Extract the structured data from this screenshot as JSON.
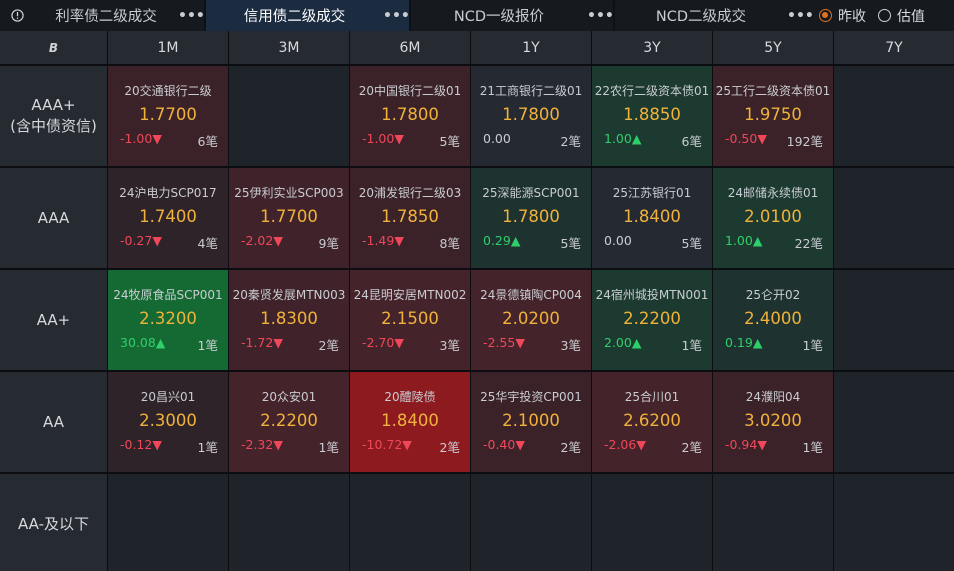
{
  "tabs": [
    {
      "label": "利率债二级成交",
      "more": "•••",
      "active": false
    },
    {
      "label": "信用债二级成交",
      "more": "•••",
      "active": true
    },
    {
      "label": "NCD一级报价",
      "more": "•••",
      "active": false
    },
    {
      "label": "NCD二级成交",
      "more": "•••",
      "active": false
    }
  ],
  "price_mode": {
    "options": [
      "昨收",
      "估值"
    ],
    "selected": "昨收"
  },
  "corner_glyph": "B",
  "columns": [
    "1M",
    "3M",
    "6M",
    "1Y",
    "3Y",
    "5Y",
    "7Y"
  ],
  "rows": [
    {
      "label": "AAA+\n(含中债资信)",
      "cells": [
        {
          "name": "20交通银行二级",
          "rate": "1.7700",
          "chg": "-1.00▼",
          "dir": "down",
          "count": "6笔",
          "bg": "#3a2228"
        },
        null,
        {
          "name": "20中国银行二级01",
          "rate": "1.7800",
          "chg": "-1.00▼",
          "dir": "down",
          "count": "5笔",
          "bg": "#3a2228"
        },
        {
          "name": "21工商银行二级01",
          "rate": "1.7800",
          "chg": "0.00",
          "dir": "flat",
          "count": "2笔",
          "bg": "#252a32"
        },
        {
          "name": "22农行二级资本债01",
          "rate": "1.8850",
          "chg": "1.00▲",
          "dir": "up",
          "count": "6笔",
          "bg": "#1c3a30"
        },
        {
          "name": "25工行二级资本债01",
          "rate": "1.9750",
          "chg": "-0.50▼",
          "dir": "down",
          "count": "192笔",
          "bg": "#3a2228"
        },
        null
      ]
    },
    {
      "label": "AAA",
      "cells": [
        {
          "name": "24沪电力SCP017",
          "rate": "1.7400",
          "chg": "-0.27▼",
          "dir": "down",
          "count": "4笔",
          "bg": "#2e2329"
        },
        {
          "name": "25伊利实业SCP003",
          "rate": "1.7700",
          "chg": "-2.02▼",
          "dir": "down",
          "count": "9笔",
          "bg": "#40232a"
        },
        {
          "name": "20浦发银行二级03",
          "rate": "1.7850",
          "chg": "-1.49▼",
          "dir": "down",
          "count": "8笔",
          "bg": "#3a2228"
        },
        {
          "name": "25深能源SCP001",
          "rate": "1.7800",
          "chg": "0.29▲",
          "dir": "up",
          "count": "5笔",
          "bg": "#1e3330"
        },
        {
          "name": "25江苏银行01",
          "rate": "1.8400",
          "chg": "0.00",
          "dir": "flat",
          "count": "5笔",
          "bg": "#252a32"
        },
        {
          "name": "24邮储永续债01",
          "rate": "2.0100",
          "chg": "1.00▲",
          "dir": "up",
          "count": "22笔",
          "bg": "#1c3a30"
        },
        null
      ]
    },
    {
      "label": "AA+",
      "cells": [
        {
          "name": "24牧原食品SCP001",
          "rate": "2.3200",
          "chg": "30.08▲",
          "dir": "up",
          "count": "1笔",
          "bg": "#156a34"
        },
        {
          "name": "20秦贤发展MTN003",
          "rate": "1.8300",
          "chg": "-1.72▼",
          "dir": "down",
          "count": "2笔",
          "bg": "#40232a"
        },
        {
          "name": "24昆明安居MTN002",
          "rate": "2.1500",
          "chg": "-2.70▼",
          "dir": "down",
          "count": "3笔",
          "bg": "#44232a"
        },
        {
          "name": "24景德镇陶CP004",
          "rate": "2.0200",
          "chg": "-2.55▼",
          "dir": "down",
          "count": "3笔",
          "bg": "#44232a"
        },
        {
          "name": "24宿州城投MTN001",
          "rate": "2.2200",
          "chg": "2.00▲",
          "dir": "up",
          "count": "1笔",
          "bg": "#1c3a30"
        },
        {
          "name": "25仑开02",
          "rate": "2.4000",
          "chg": "0.19▲",
          "dir": "up",
          "count": "1笔",
          "bg": "#1e3330"
        },
        null
      ]
    },
    {
      "label": "AA",
      "cells": [
        {
          "name": "20昌兴01",
          "rate": "2.3000",
          "chg": "-0.12▼",
          "dir": "down",
          "count": "1笔",
          "bg": "#2e2329"
        },
        {
          "name": "20众安01",
          "rate": "2.2200",
          "chg": "-2.32▼",
          "dir": "down",
          "count": "1笔",
          "bg": "#44232a"
        },
        {
          "name": "20醴陵债",
          "rate": "1.8400",
          "chg": "-10.72▼",
          "dir": "down",
          "count": "2笔",
          "bg": "#8c1a1f"
        },
        {
          "name": "25华宇投资CP001",
          "rate": "2.1000",
          "chg": "-0.40▼",
          "dir": "down",
          "count": "2笔",
          "bg": "#3a2228"
        },
        {
          "name": "25合川01",
          "rate": "2.6200",
          "chg": "-2.06▼",
          "dir": "down",
          "count": "2笔",
          "bg": "#44232a"
        },
        {
          "name": "24濮阳04",
          "rate": "3.0200",
          "chg": "-0.94▼",
          "dir": "down",
          "count": "1笔",
          "bg": "#3a2228"
        },
        null
      ]
    },
    {
      "label": "AA-及以下",
      "cells": [
        null,
        null,
        null,
        null,
        null,
        null,
        null
      ]
    }
  ],
  "colors": {
    "rate": "#f0b23a",
    "up": "#2ecf6a",
    "down": "#f0475a",
    "active_tab": "#1b2b40",
    "radio_on": "#e0711d"
  }
}
